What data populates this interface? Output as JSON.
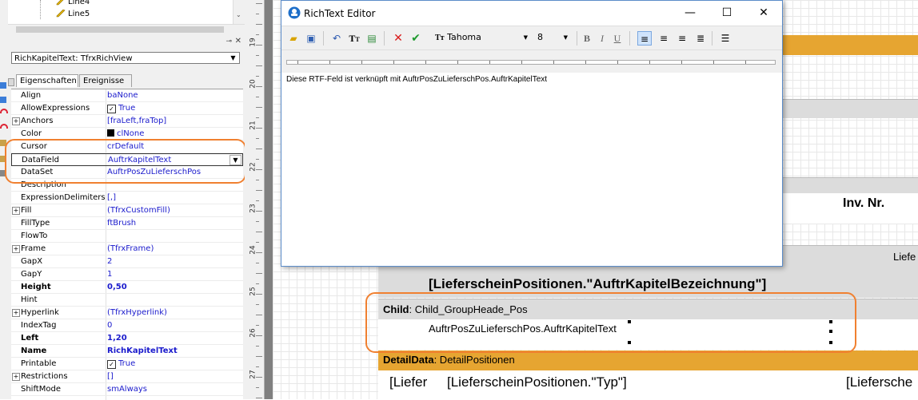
{
  "tree": {
    "items": [
      "Line4",
      "Line5"
    ]
  },
  "object_selector": {
    "value": "RichKapitelText: TfrxRichView"
  },
  "inspector_tabs": [
    "Eigenschaften",
    "Ereignisse"
  ],
  "properties": [
    {
      "name": "Align",
      "value": "baNone"
    },
    {
      "name": "AllowExpressions",
      "value": "True",
      "check": true
    },
    {
      "name": "Anchors",
      "value": "[fraLeft,fraTop]",
      "expand": true
    },
    {
      "name": "Color",
      "value": "clNone",
      "color": "#000000"
    },
    {
      "name": "Cursor",
      "value": "crDefault"
    },
    {
      "name": "DataField",
      "value": "AuftrKapitelText",
      "dropdown": true
    },
    {
      "name": "DataSet",
      "value": "AuftrPosZuLieferschPos"
    },
    {
      "name": "Description",
      "value": ""
    },
    {
      "name": "ExpressionDelimiters",
      "value": "[,]"
    },
    {
      "name": "Fill",
      "value": "(TfrxCustomFill)",
      "expand": true
    },
    {
      "name": "FillType",
      "value": "ftBrush"
    },
    {
      "name": "FlowTo",
      "value": ""
    },
    {
      "name": "Frame",
      "value": "(TfrxFrame)",
      "expand": true
    },
    {
      "name": "GapX",
      "value": "2"
    },
    {
      "name": "GapY",
      "value": "1"
    },
    {
      "name": "Height",
      "value": "0,50",
      "bold": true
    },
    {
      "name": "Hint",
      "value": ""
    },
    {
      "name": "Hyperlink",
      "value": "(TfrxHyperlink)",
      "expand": true
    },
    {
      "name": "IndexTag",
      "value": "0"
    },
    {
      "name": "Left",
      "value": "1,20",
      "bold": true
    },
    {
      "name": "Name",
      "value": "RichKapitelText",
      "bold": true
    },
    {
      "name": "Printable",
      "value": "True",
      "check": true
    },
    {
      "name": "Restrictions",
      "value": "[]",
      "expand": true
    },
    {
      "name": "ShiftMode",
      "value": "smAlways"
    }
  ],
  "ruler": {
    "numbers": [
      "19",
      "20",
      "21",
      "22",
      "23",
      "24",
      "25",
      "26",
      "27"
    ]
  },
  "editor": {
    "title": "RichText Editor",
    "font_name": "Tahoma",
    "font_size": "8",
    "text": "Diese RTF-Feld ist verknüpft mit AuftrPosZuLieferschPos.AuftrKapitelText",
    "icon_color": "#1e6fc9"
  },
  "report": {
    "inv_nr": "Inv. Nr.",
    "liefer_partial": "Liefe",
    "kapitel_bez": "[LieferscheinPositionen.\"AuftrKapitelBezeichnung\"]",
    "child_label": "Child",
    "child_name": ": Child_GroupHeade_Pos",
    "child_text": "AuftrPosZuLieferschPos.AuftrKapitelText",
    "detail_label": "DetailData",
    "detail_name": ": DetailPositionen",
    "col1": "[Liefer",
    "col2": "[LieferscheinPositionen.\"Typ\"]",
    "col3": "[Liefersche",
    "band_color": "#e6a531",
    "highlight_color": "#f08030"
  }
}
